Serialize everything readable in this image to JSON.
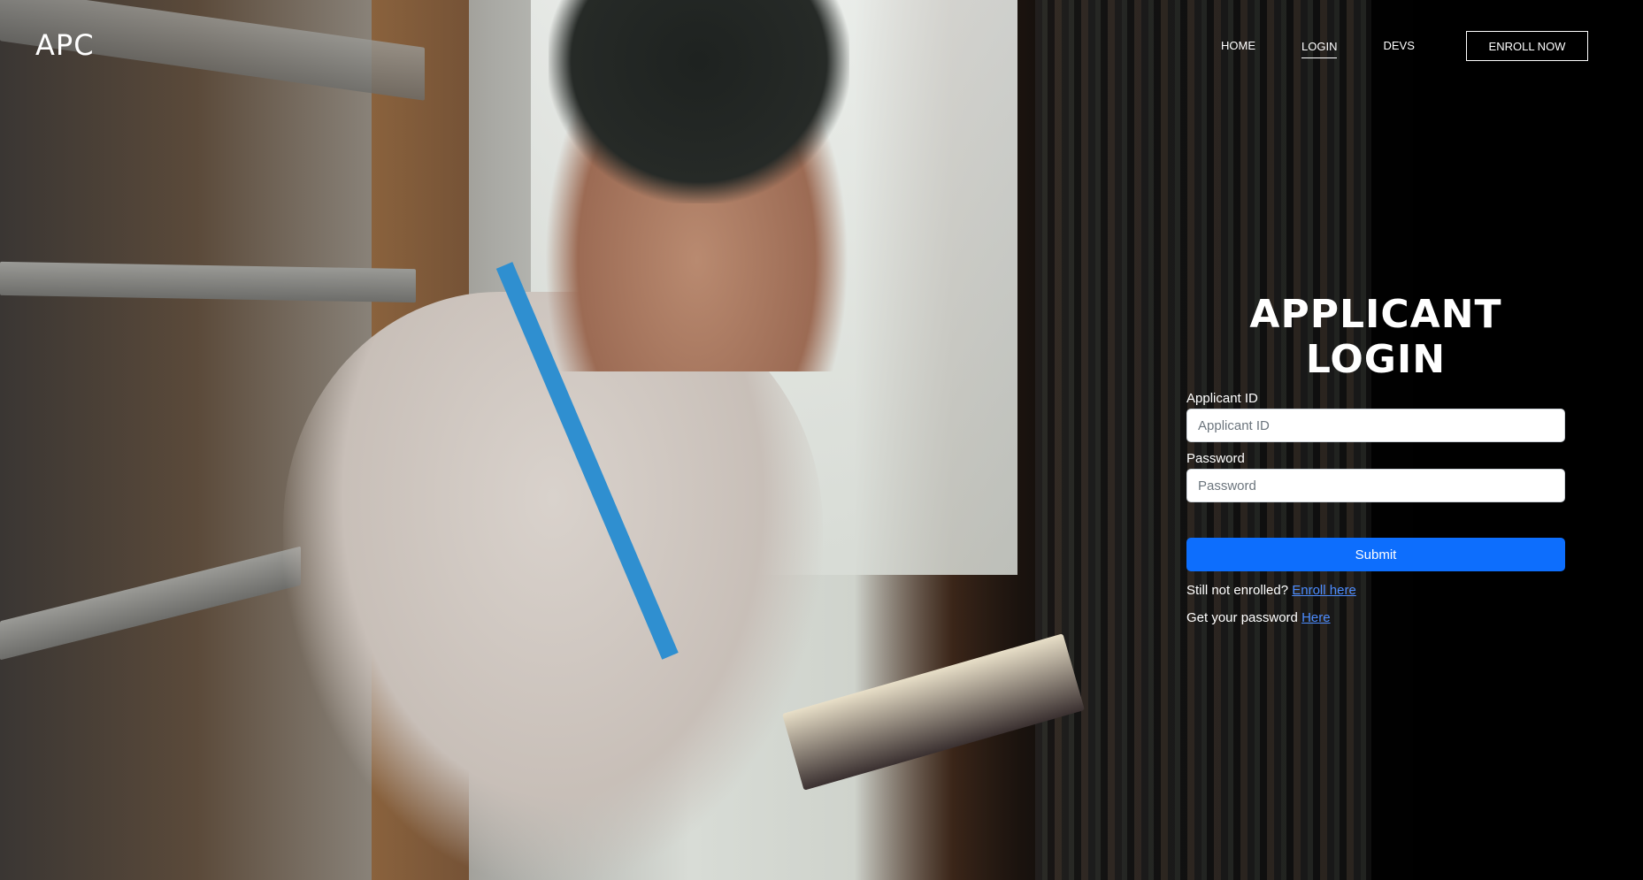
{
  "brand": {
    "logo_text": "APC"
  },
  "nav": {
    "items": [
      {
        "label": "HOME"
      },
      {
        "label": "LOGIN",
        "active": true
      },
      {
        "label": "DEVS"
      }
    ],
    "enroll_label": "ENROLL NOW"
  },
  "login": {
    "title": "APPLICANT LOGIN",
    "applicant_id": {
      "label": "Applicant ID",
      "placeholder": "Applicant ID",
      "value": ""
    },
    "password": {
      "label": "Password",
      "placeholder": "Password",
      "value": ""
    },
    "submit_label": "Submit",
    "enroll_prompt": "Still not enrolled?",
    "enroll_link": "Enroll here",
    "password_prompt": "Get your password",
    "password_link": "Here"
  },
  "colors": {
    "primary": "#0d6efd",
    "link": "#4d8dff",
    "text": "#ffffff"
  },
  "icons": []
}
